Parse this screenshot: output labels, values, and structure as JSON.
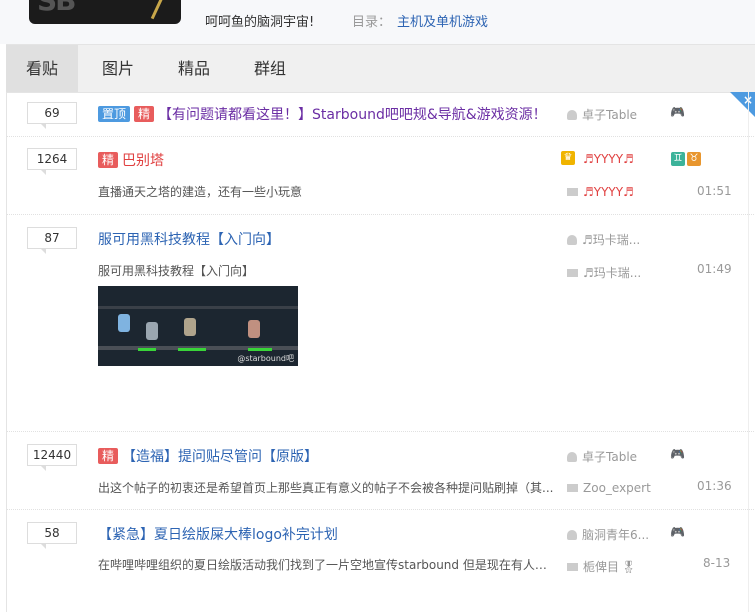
{
  "header": {
    "slogan": "呵呵鱼的脑洞宇宙!",
    "directory_label": "目录：",
    "directory_link": "主机及单机游戏"
  },
  "tabs": [
    {
      "label": "看贴",
      "active": true
    },
    {
      "label": "图片",
      "active": false
    },
    {
      "label": "精品",
      "active": false
    },
    {
      "label": "群组",
      "active": false
    }
  ],
  "corner_close": "×",
  "threads": [
    {
      "replies": "69",
      "tags": [
        "置顶",
        "精"
      ],
      "title": "【有问题请都看这里！】Starbound吧吧规&导航&游戏资源！",
      "author": "卓子Table",
      "icon": "game-controller-icon"
    },
    {
      "replies": "1264",
      "tags": [
        "精"
      ],
      "title": "巴别塔",
      "author": "♬YYYY♬",
      "abstract": "直播通天之塔的建造，还有一些小玩意",
      "last_reply": "♬YYYY♬",
      "time": "01:51"
    },
    {
      "replies": "87",
      "tags": [],
      "title": "服可用黑科技教程【入门向】",
      "author": "♬玛卡瑞...",
      "abstract": "服可用黑科技教程【入门向】",
      "last_reply": "♬玛卡瑞...",
      "time": "01:49",
      "thumb_watermark": "@starbound吧"
    },
    {
      "replies": "12440",
      "tags": [
        "精"
      ],
      "title": "【造福】提问贴尽管问【原版】",
      "author": "卓子Table",
      "abstract": "出这个帖子的初衷还是希望首页上那些真正有意义的帖子不会被各种提问贴刷掉（其...",
      "last_reply": "Zoo_expert",
      "time": "01:36",
      "icon": "game-controller-icon"
    },
    {
      "replies": "58",
      "tags": [],
      "title": "【紧急】夏日绘版屎大棒logo补完计划",
      "author": "脑洞青年6...",
      "abstract": "在哔哩哔哩组织的夏日绘版活动我们找到了一片空地宣传starbound 但是现在有人捣...",
      "last_reply": "栀俾目",
      "time": "8-13",
      "icon": "game-controller-icon"
    }
  ]
}
